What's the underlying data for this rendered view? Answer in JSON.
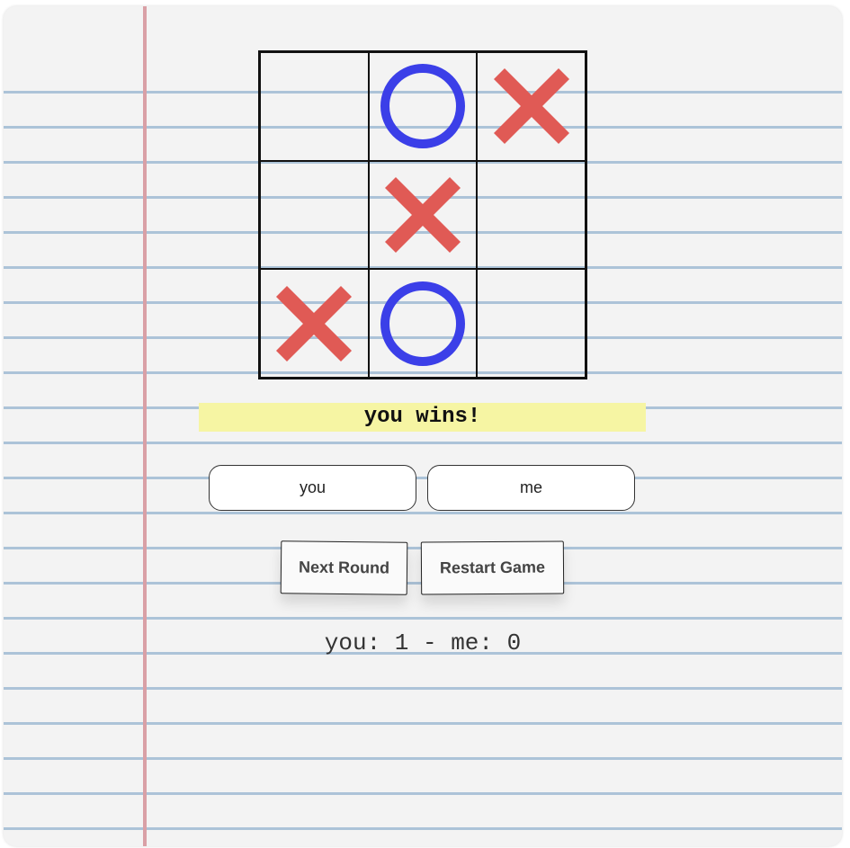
{
  "board": [
    {
      "mark": ""
    },
    {
      "mark": "O"
    },
    {
      "mark": "X"
    },
    {
      "mark": ""
    },
    {
      "mark": "X"
    },
    {
      "mark": ""
    },
    {
      "mark": "X"
    },
    {
      "mark": "O"
    },
    {
      "mark": ""
    }
  ],
  "colors": {
    "x": "#e05a55",
    "o": "#3b3fe8",
    "highlight": "#f6f5a3",
    "rule_line": "#9fbad2",
    "margin_line": "#d9a0a6"
  },
  "status": {
    "text": "you wins!"
  },
  "players": {
    "player1_name": "you",
    "player2_name": "me"
  },
  "controls": {
    "next_round_label": "Next Round",
    "restart_label": "Restart Game"
  },
  "score": {
    "text": "you: 1 - me: 0"
  }
}
